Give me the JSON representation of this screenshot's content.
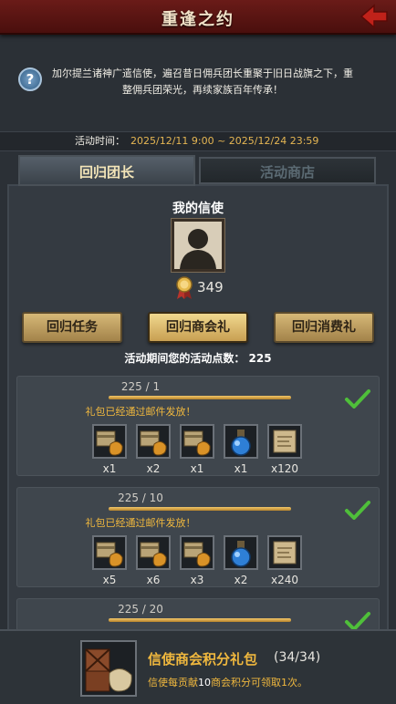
{
  "header": {
    "title": "重逢之约"
  },
  "info": {
    "text": "加尔提兰诸神广遣信使，遍召昔日佣兵团长重聚于旧日战旗之下，重整佣兵团荣光，再续家族百年传承！"
  },
  "event_time": {
    "label": "活动时间：",
    "value": "2025/12/11 9:00 ~ 2025/12/24 23:59"
  },
  "tabs": [
    {
      "label": "回归团长"
    },
    {
      "label": "活动商店"
    }
  ],
  "messenger": {
    "heading": "我的信使",
    "score": "349"
  },
  "buttons": [
    {
      "label": "回归任务"
    },
    {
      "label": "回归商会礼"
    },
    {
      "label": "回归消费礼"
    }
  ],
  "points": {
    "text": "活动期间您的活动点数：  225"
  },
  "rewards": [
    {
      "progress": "225 / 1",
      "message": "礼包已经通过邮件发放！",
      "quantities": [
        "x1",
        "x2",
        "x1",
        "x1",
        "x120"
      ]
    },
    {
      "progress": "225 / 10",
      "message": "礼包已经通过邮件发放！",
      "quantities": [
        "x5",
        "x6",
        "x3",
        "x2",
        "x240"
      ]
    },
    {
      "progress": "225 / 20"
    }
  ],
  "footer": {
    "title": "信使商会积分礼包",
    "count": "(34/34)",
    "desc_prefix": "信使每贡献",
    "desc_num": "10",
    "desc_suffix": "商会积分可领取1次。"
  },
  "icons": {
    "back": "back-arrow-icon",
    "help": "question-icon",
    "check": "checkmark-icon",
    "medal": "medal-icon"
  },
  "colors": {
    "accent_gold": "#f0b83e",
    "title_red": "#6a1b18",
    "check_green": "#4fbf3a"
  }
}
